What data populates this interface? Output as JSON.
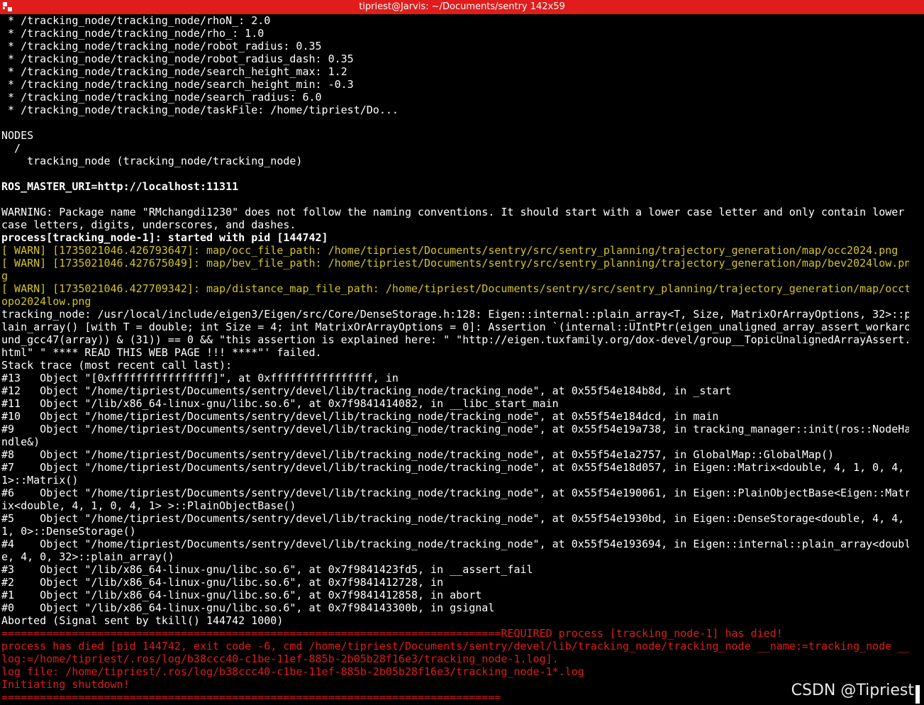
{
  "window": {
    "title": "tipriest@Jarvis: ~/Documents/sentry 142x59"
  },
  "watermark": "CSDN @Tipriest",
  "colors": {
    "titlebar": "#e01c1c",
    "background": "#000000",
    "warn": "#d4c51f",
    "error": "#e01c1c"
  },
  "lines": [
    {
      "t": " * /tracking_node/tracking_node/rhoN_: 2.0",
      "c": "white"
    },
    {
      "t": " * /tracking_node/tracking_node/rho_: 1.0",
      "c": "white"
    },
    {
      "t": " * /tracking_node/tracking_node/robot_radius: 0.35",
      "c": "white"
    },
    {
      "t": " * /tracking_node/tracking_node/robot_radius_dash: 0.35",
      "c": "white"
    },
    {
      "t": " * /tracking_node/tracking_node/search_height_max: 1.2",
      "c": "white"
    },
    {
      "t": " * /tracking_node/tracking_node/search_height_min: -0.3",
      "c": "white"
    },
    {
      "t": " * /tracking_node/tracking_node/search_radius: 6.0",
      "c": "white"
    },
    {
      "t": " * /tracking_node/tracking_node/taskFile: /home/tipriest/Do...",
      "c": "white"
    },
    {
      "t": "",
      "c": "white"
    },
    {
      "t": "NODES",
      "c": "white"
    },
    {
      "t": "  /",
      "c": "white"
    },
    {
      "t": "    tracking_node (tracking_node/tracking_node)",
      "c": "white"
    },
    {
      "t": "",
      "c": "white"
    },
    {
      "t": "ROS_MASTER_URI=http://localhost:11311",
      "c": "white bold"
    },
    {
      "t": "",
      "c": "white"
    },
    {
      "t": "WARNING: Package name \"RMchangdi1230\" does not follow the naming conventions. It should start with a lower case letter and only contain lower",
      "c": "white"
    },
    {
      "t": "case letters, digits, underscores, and dashes.",
      "c": "white"
    },
    {
      "t": "process[tracking_node-1]: started with pid [144742]",
      "c": "white bold"
    },
    {
      "t": "[ WARN] [1735021046.426793647]: map/occ_file_path: /home/tipriest/Documents/sentry/src/sentry_planning/trajectory_generation/map/occ2024.png",
      "c": "yellow"
    },
    {
      "t": "[ WARN] [1735021046.427675049]: map/bev_file_path: /home/tipriest/Documents/sentry/src/sentry_planning/trajectory_generation/map/bev2024low.pn",
      "c": "yellow"
    },
    {
      "t": "g",
      "c": "yellow"
    },
    {
      "t": "[ WARN] [1735021046.427709342]: map/distance_map_file_path: /home/tipriest/Documents/sentry/src/sentry_planning/trajectory_generation/map/occt",
      "c": "yellow"
    },
    {
      "t": "opo2024low.png",
      "c": "yellow"
    },
    {
      "t": "tracking_node: /usr/local/include/eigen3/Eigen/src/Core/DenseStorage.h:128: Eigen::internal::plain_array<T, Size, MatrixOrArrayOptions, 32>::p",
      "c": "white"
    },
    {
      "t": "lain_array() [with T = double; int Size = 4; int MatrixOrArrayOptions = 0]: Assertion `(internal::UIntPtr(eigen_unaligned_array_assert_workaro",
      "c": "white"
    },
    {
      "t": "und_gcc47(array)) & (31)) == 0 && \"this assertion is explained here: \" \"http://eigen.tuxfamily.org/dox-devel/group__TopicUnalignedArrayAssert.",
      "c": "white"
    },
    {
      "t": "html\" \" **** READ THIS WEB PAGE !!! ****\"' failed.",
      "c": "white"
    },
    {
      "t": "Stack trace (most recent call last):",
      "c": "white"
    },
    {
      "t": "#13   Object \"[0xffffffffffffffff]\", at 0xffffffffffffffff, in",
      "c": "white"
    },
    {
      "t": "#12   Object \"/home/tipriest/Documents/sentry/devel/lib/tracking_node/tracking_node\", at 0x55f54e184b8d, in _start",
      "c": "white"
    },
    {
      "t": "#11   Object \"/lib/x86_64-linux-gnu/libc.so.6\", at 0x7f9841414082, in __libc_start_main",
      "c": "white"
    },
    {
      "t": "#10   Object \"/home/tipriest/Documents/sentry/devel/lib/tracking_node/tracking_node\", at 0x55f54e184dcd, in main",
      "c": "white"
    },
    {
      "t": "#9    Object \"/home/tipriest/Documents/sentry/devel/lib/tracking_node/tracking_node\", at 0x55f54e19a738, in tracking_manager::init(ros::NodeHa",
      "c": "white"
    },
    {
      "t": "ndle&)",
      "c": "white"
    },
    {
      "t": "#8    Object \"/home/tipriest/Documents/sentry/devel/lib/tracking_node/tracking_node\", at 0x55f54e1a2757, in GlobalMap::GlobalMap()",
      "c": "white"
    },
    {
      "t": "#7    Object \"/home/tipriest/Documents/sentry/devel/lib/tracking_node/tracking_node\", at 0x55f54e18d057, in Eigen::Matrix<double, 4, 1, 0, 4,",
      "c": "white"
    },
    {
      "t": "1>::Matrix()",
      "c": "white"
    },
    {
      "t": "#6    Object \"/home/tipriest/Documents/sentry/devel/lib/tracking_node/tracking_node\", at 0x55f54e190061, in Eigen::PlainObjectBase<Eigen::Matr",
      "c": "white"
    },
    {
      "t": "ix<double, 4, 1, 0, 4, 1> >::PlainObjectBase()",
      "c": "white"
    },
    {
      "t": "#5    Object \"/home/tipriest/Documents/sentry/devel/lib/tracking_node/tracking_node\", at 0x55f54e1930bd, in Eigen::DenseStorage<double, 4, 4,",
      "c": "white"
    },
    {
      "t": "1, 0>::DenseStorage()",
      "c": "white"
    },
    {
      "t": "#4    Object \"/home/tipriest/Documents/sentry/devel/lib/tracking_node/tracking_node\", at 0x55f54e193694, in Eigen::internal::plain_array<doubl",
      "c": "white"
    },
    {
      "t": "e, 4, 0, 32>::plain_array()",
      "c": "white"
    },
    {
      "t": "#3    Object \"/lib/x86_64-linux-gnu/libc.so.6\", at 0x7f9841423fd5, in __assert_fail",
      "c": "white"
    },
    {
      "t": "#2    Object \"/lib/x86_64-linux-gnu/libc.so.6\", at 0x7f9841412728, in",
      "c": "white"
    },
    {
      "t": "#1    Object \"/lib/x86_64-linux-gnu/libc.so.6\", at 0x7f9841412858, in abort",
      "c": "white"
    },
    {
      "t": "#0    Object \"/lib/x86_64-linux-gnu/libc.so.6\", at 0x7f984143300b, in gsignal",
      "c": "white"
    },
    {
      "t": "Aborted (Signal sent by tkill() 144742 1000)",
      "c": "white"
    },
    {
      "t": "==============================================================================REQUIRED process [tracking_node-1] has died!",
      "c": "red"
    },
    {
      "t": "process has died [pid 144742, exit code -6, cmd /home/tipriest/Documents/sentry/devel/lib/tracking_node/tracking_node __name:=tracking_node __",
      "c": "red"
    },
    {
      "t": "log:=/home/tipriest/.ros/log/b38ccc40-c1be-11ef-885b-2b05b28f16e3/tracking_node-1.log].",
      "c": "red"
    },
    {
      "t": "log file: /home/tipriest/.ros/log/b38ccc40-c1be-11ef-885b-2b05b28f16e3/tracking_node-1*.log",
      "c": "red"
    },
    {
      "t": "Initiating shutdown!",
      "c": "red"
    },
    {
      "t": "==============================================================================",
      "c": "red"
    }
  ]
}
